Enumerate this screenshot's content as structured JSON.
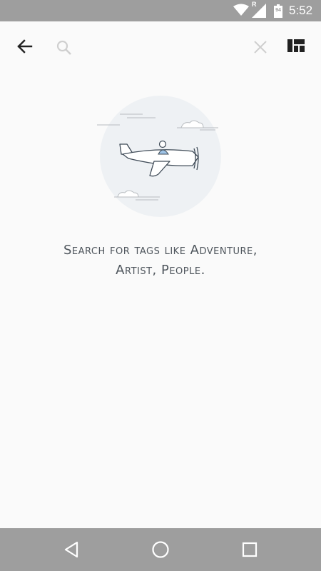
{
  "status_bar": {
    "time": "5:52",
    "battery_level": "94",
    "roaming_indicator": "R",
    "icons": [
      "wifi-icon",
      "cellular-signal-icon",
      "battery-icon"
    ]
  },
  "toolbar": {
    "back_icon": "arrow-left-icon",
    "search_icon": "search-icon",
    "search_value": "",
    "search_placeholder": "",
    "clear_icon": "close-icon",
    "layout_icon": "grid-layout-icon"
  },
  "empty_state": {
    "illustration": "airplane-with-clouds",
    "line1": "Search for tags like Adventure,",
    "line2": "Artist, People."
  },
  "nav_bar": {
    "icons": [
      "nav-back-icon",
      "nav-home-icon",
      "nav-recents-icon"
    ]
  },
  "colors": {
    "status_bar_bg": "#9e9e9e",
    "nav_bar_bg": "#9e9e9e",
    "page_bg": "#fafafa",
    "text": "#4e555c",
    "illustration_circle": "#eef1f4",
    "pilot_accent": "#9ec3e6"
  }
}
